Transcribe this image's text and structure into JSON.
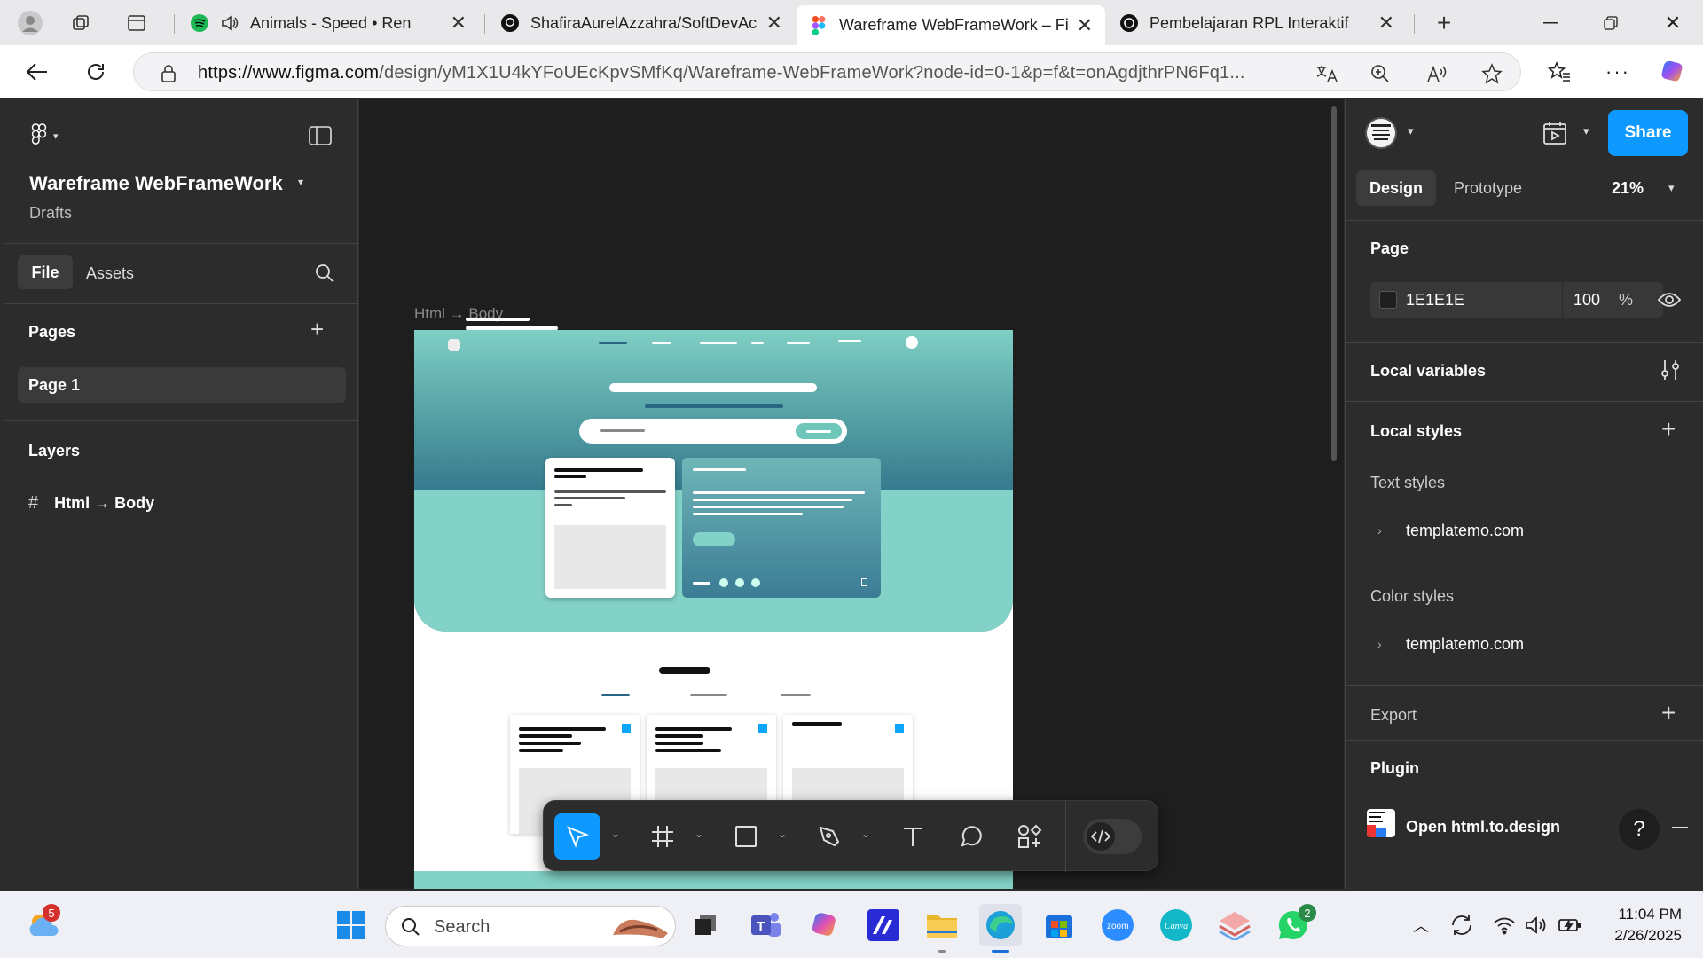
{
  "browser": {
    "tabs": [
      {
        "title": "Animals - Speed • Ren",
        "icon": "spotify-icon"
      },
      {
        "title": "ShafiraAurelAzzahra/SoftDevAca",
        "icon": "github-icon"
      },
      {
        "title": "Wareframe WebFrameWork – Fig",
        "icon": "figma-icon",
        "active": true
      },
      {
        "title": "Pembelajaran RPL Interaktif",
        "icon": "chatgpt-icon"
      }
    ],
    "url_domain": "https://www.figma.com",
    "url_rest": "/design/yM1X1U4kYFoUEcKpvSMfKq/Wareframe-WebFrameWork?node-id=0-1&p=f&t=onAgdjthrPN6Fq1..."
  },
  "left_panel": {
    "file_name": "Wareframe WebFrameWork",
    "location": "Drafts",
    "tabs": [
      "File",
      "Assets"
    ],
    "pages_heading": "Pages",
    "pages": [
      "Page 1"
    ],
    "layers_heading": "Layers",
    "layers": [
      "Html → Body"
    ]
  },
  "canvas": {
    "frame_label": "Html → Body"
  },
  "right_panel": {
    "share_label": "Share",
    "tabs": [
      "Design",
      "Prototype"
    ],
    "zoom": "21%",
    "page_heading": "Page",
    "page_color": "1E1E1E",
    "page_opacity": "100",
    "percent": "%",
    "local_variables": "Local variables",
    "local_styles": "Local styles",
    "text_styles": "Text styles",
    "text_style_item": "templatemo.com",
    "color_styles": "Color styles",
    "color_style_item": "templatemo.com",
    "export": "Export",
    "plugin": "Plugin",
    "plugin_item": "Open html.to.design",
    "help": "?"
  },
  "taskbar": {
    "search_placeholder": "Search",
    "weather_badge": "5",
    "whatsapp_badge": "2",
    "time": "11:04 PM",
    "date": "2/26/2025"
  },
  "colors": {
    "figma_blue": "#0d99ff",
    "canvas_bg": "#1e1e1e",
    "panel_bg": "#2c2c2c",
    "mint": "#82d2c7",
    "teal_dark": "#2a6684"
  }
}
